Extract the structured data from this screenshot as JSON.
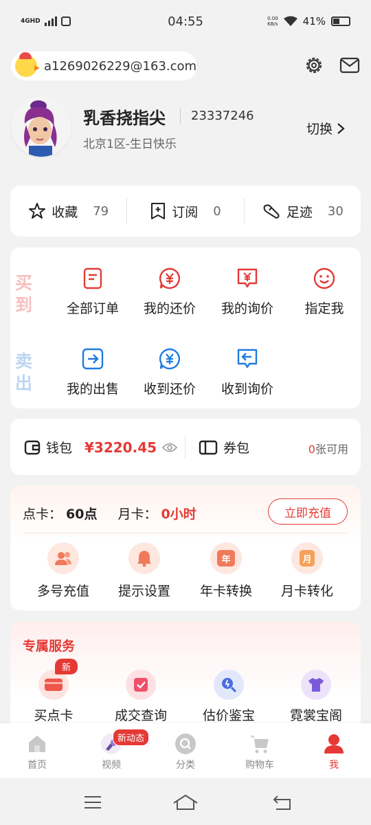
{
  "status": {
    "net": "4GHD",
    "time": "04:55",
    "speed_value": "0.00",
    "speed_unit": "KB/s",
    "battery": "41%",
    "battery_level": 0.41
  },
  "header": {
    "account": "a1269026229@163.com"
  },
  "profile": {
    "nickname": "乳香挠指尖",
    "uid": "23337246",
    "server": "北京1区-生日快乐",
    "switch_label": "切换"
  },
  "stats": [
    {
      "label": "收藏",
      "count": "79"
    },
    {
      "label": "订阅",
      "count": "0"
    },
    {
      "label": "足迹",
      "count": "30"
    }
  ],
  "orders": {
    "buy_label": "买到",
    "sell_label": "卖出",
    "buy_items": [
      "全部订单",
      "我的还价",
      "我的询价",
      "指定我"
    ],
    "sell_items": [
      "我的出售",
      "收到还价",
      "收到询价"
    ]
  },
  "wallet": {
    "wallet_label": "钱包",
    "amount": "¥3220.45",
    "coupon_label": "券包",
    "coupon_count": "0",
    "coupon_suffix": "张可用"
  },
  "recharge": {
    "point_label": "点卡：",
    "point_value": "60点",
    "month_label": "月卡：",
    "month_value": "0小时",
    "button": "立即充值",
    "items": [
      "多号充值",
      "提示设置",
      "年卡转换",
      "月卡转化"
    ],
    "icon_glyphs": {
      "year": "年",
      "month": "月"
    }
  },
  "exclusive": {
    "title": "专属服务",
    "badge": "新",
    "items": [
      "买点卡",
      "成交查询",
      "估价鉴宝",
      "霓裳宝阁"
    ]
  },
  "tabbar": {
    "items": [
      "首页",
      "视频",
      "分类",
      "购物车",
      "我"
    ],
    "badge": "新动态"
  },
  "colors": {
    "accent": "#e53935",
    "blue": "#1e7be0"
  }
}
